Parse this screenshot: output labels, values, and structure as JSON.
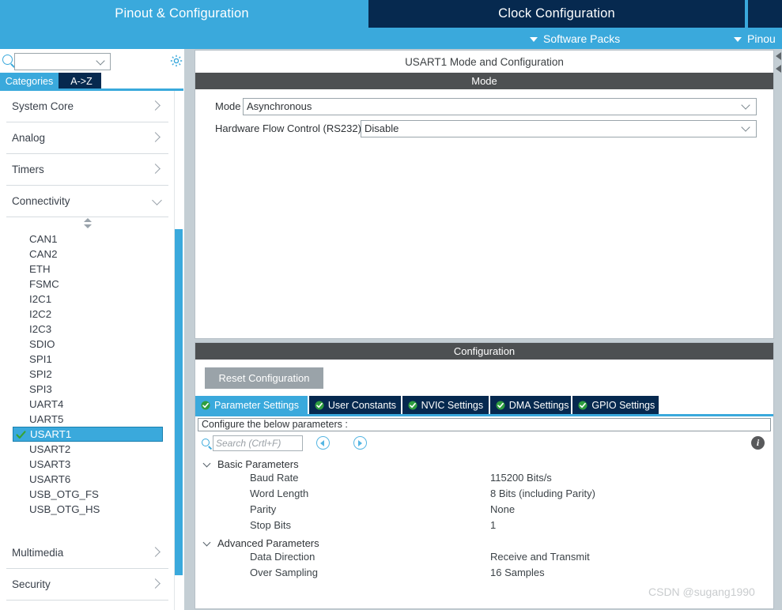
{
  "header": {
    "tabs": [
      {
        "label": "Pinout & Configuration",
        "state": "active"
      },
      {
        "label": "Clock Configuration",
        "state": "inactive"
      },
      {
        "label": "",
        "state": "inactive"
      }
    ],
    "subbar": [
      {
        "label": "Software Packs",
        "icon": "chevron-down-icon"
      },
      {
        "label": "Pinou",
        "icon": "chevron-down-icon"
      }
    ]
  },
  "sidebar": {
    "search": {
      "value": "",
      "icon": "search-icon"
    },
    "gear_icon": "gear-icon",
    "view_tabs": [
      {
        "label": "Categories",
        "selected": true
      },
      {
        "label": "A->Z",
        "selected": false
      }
    ],
    "categories": [
      {
        "label": "System Core",
        "expanded": false
      },
      {
        "label": "Analog",
        "expanded": false
      },
      {
        "label": "Timers",
        "expanded": false
      },
      {
        "label": "Connectivity",
        "expanded": true
      }
    ],
    "peripherals": [
      {
        "label": "CAN1",
        "selected": false,
        "configured": false
      },
      {
        "label": "CAN2",
        "selected": false,
        "configured": false
      },
      {
        "label": "ETH",
        "selected": false,
        "configured": false
      },
      {
        "label": "FSMC",
        "selected": false,
        "configured": false
      },
      {
        "label": "I2C1",
        "selected": false,
        "configured": false
      },
      {
        "label": "I2C2",
        "selected": false,
        "configured": false
      },
      {
        "label": "I2C3",
        "selected": false,
        "configured": false
      },
      {
        "label": "SDIO",
        "selected": false,
        "configured": false
      },
      {
        "label": "SPI1",
        "selected": false,
        "configured": false
      },
      {
        "label": "SPI2",
        "selected": false,
        "configured": false
      },
      {
        "label": "SPI3",
        "selected": false,
        "configured": false
      },
      {
        "label": "UART4",
        "selected": false,
        "configured": false
      },
      {
        "label": "UART5",
        "selected": false,
        "configured": false
      },
      {
        "label": "USART1",
        "selected": true,
        "configured": true
      },
      {
        "label": "USART2",
        "selected": false,
        "configured": false
      },
      {
        "label": "USART3",
        "selected": false,
        "configured": false
      },
      {
        "label": "USART6",
        "selected": false,
        "configured": false
      },
      {
        "label": "USB_OTG_FS",
        "selected": false,
        "configured": false
      },
      {
        "label": "USB_OTG_HS",
        "selected": false,
        "configured": false
      }
    ],
    "categories_bottom": [
      {
        "label": "Multimedia",
        "expanded": false
      },
      {
        "label": "Security",
        "expanded": false
      }
    ]
  },
  "mode_panel": {
    "title": "USART1 Mode and Configuration",
    "section_header": "Mode",
    "fields": [
      {
        "label": "Mode",
        "value": "Asynchronous"
      },
      {
        "label": "Hardware Flow Control (RS232)",
        "value": "Disable"
      }
    ]
  },
  "config_panel": {
    "section_header": "Configuration",
    "reset_button": "Reset Configuration",
    "tabs": [
      {
        "label": "Parameter Settings",
        "active": true
      },
      {
        "label": "User Constants",
        "active": false
      },
      {
        "label": "NVIC Settings",
        "active": false
      },
      {
        "label": "DMA Settings",
        "active": false
      },
      {
        "label": "GPIO Settings",
        "active": false
      }
    ],
    "note": "Configure the below parameters :",
    "search": {
      "placeholder": "Search (Crtl+F)",
      "value": ""
    },
    "nav_prev_icon": "chevron-left-circle-icon",
    "nav_next_icon": "chevron-right-circle-icon",
    "info_icon": "info-icon",
    "info_glyph": "i",
    "groups": [
      {
        "name": "Basic Parameters",
        "expanded": true,
        "params": [
          {
            "name": "Baud Rate",
            "value": "115200 Bits/s"
          },
          {
            "name": "Word Length",
            "value": "8 Bits (including Parity)"
          },
          {
            "name": "Parity",
            "value": "None"
          },
          {
            "name": "Stop Bits",
            "value": "1"
          }
        ]
      },
      {
        "name": "Advanced Parameters",
        "expanded": true,
        "params": [
          {
            "name": "Data Direction",
            "value": "Receive and Transmit"
          },
          {
            "name": "Over Sampling",
            "value": "16 Samples"
          }
        ]
      }
    ]
  },
  "watermark": "CSDN @sugang1990",
  "colors": {
    "accent_light_blue": "#3aa9dc",
    "accent_dark_navy": "#06294f",
    "section_header_gray": "#4d5052",
    "panel_bg_gray": "#c4ced4",
    "check_green": "#38a334",
    "reset_button_gray": "#9aa3a9"
  }
}
